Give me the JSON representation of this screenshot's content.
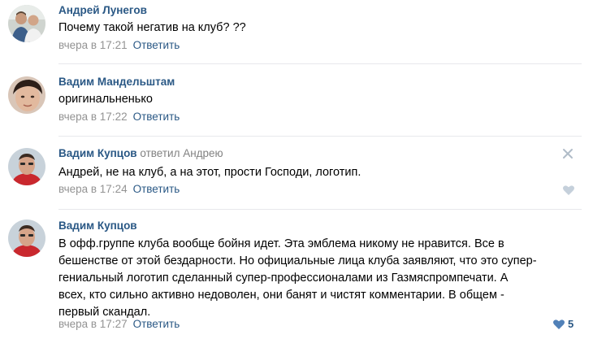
{
  "comments": [
    {
      "author": "Андрей Лунегов",
      "replied_to": "",
      "text": "Почему такой негатив на клуб? ??",
      "time": "вчера в 17:21",
      "reply_label": "Ответить",
      "avatar_icon": "avatar-two-men-photo"
    },
    {
      "author": "Вадим Мандельштам",
      "replied_to": "",
      "text": "оригинальненько",
      "time": "вчера в 17:22",
      "reply_label": "Ответить",
      "avatar_icon": "avatar-face-photo"
    },
    {
      "author": "Вадим Купцов",
      "replied_to": "ответил Андрею",
      "text": "Андрей, не на клуб, а на этот, прости Господи, логотип.",
      "time": "вчера в 17:24",
      "reply_label": "Ответить",
      "avatar_icon": "avatar-red-shirt-photo",
      "close_icon": "close-icon",
      "like_icon": "heart-icon"
    },
    {
      "author": "Вадим Купцов",
      "replied_to": "",
      "text_lines": [
        "В офф.группе клуба вообще бойня идет. Эта эмблема никому не нравится. Все в",
        "бешенстве от этой бездарности. Но официальные лица клуба заявляют, что это супер-",
        "гениальный логотип сделанный супер-профессионалами из Газмяспромпечати. А",
        "всех, кто сильно активно недоволен, они банят и чистят комментарии. В общем -",
        "первый скандал."
      ],
      "time": "вчера в 17:27",
      "reply_label": "Ответить",
      "avatar_icon": "avatar-red-shirt-photo",
      "like_icon": "heart-icon",
      "like_count": "5"
    }
  ],
  "colors": {
    "link": "#2a5885",
    "meta": "#939393",
    "divider": "#e7e8ec",
    "like_active": "#5181b8",
    "like_inactive": "#c5d0db"
  }
}
